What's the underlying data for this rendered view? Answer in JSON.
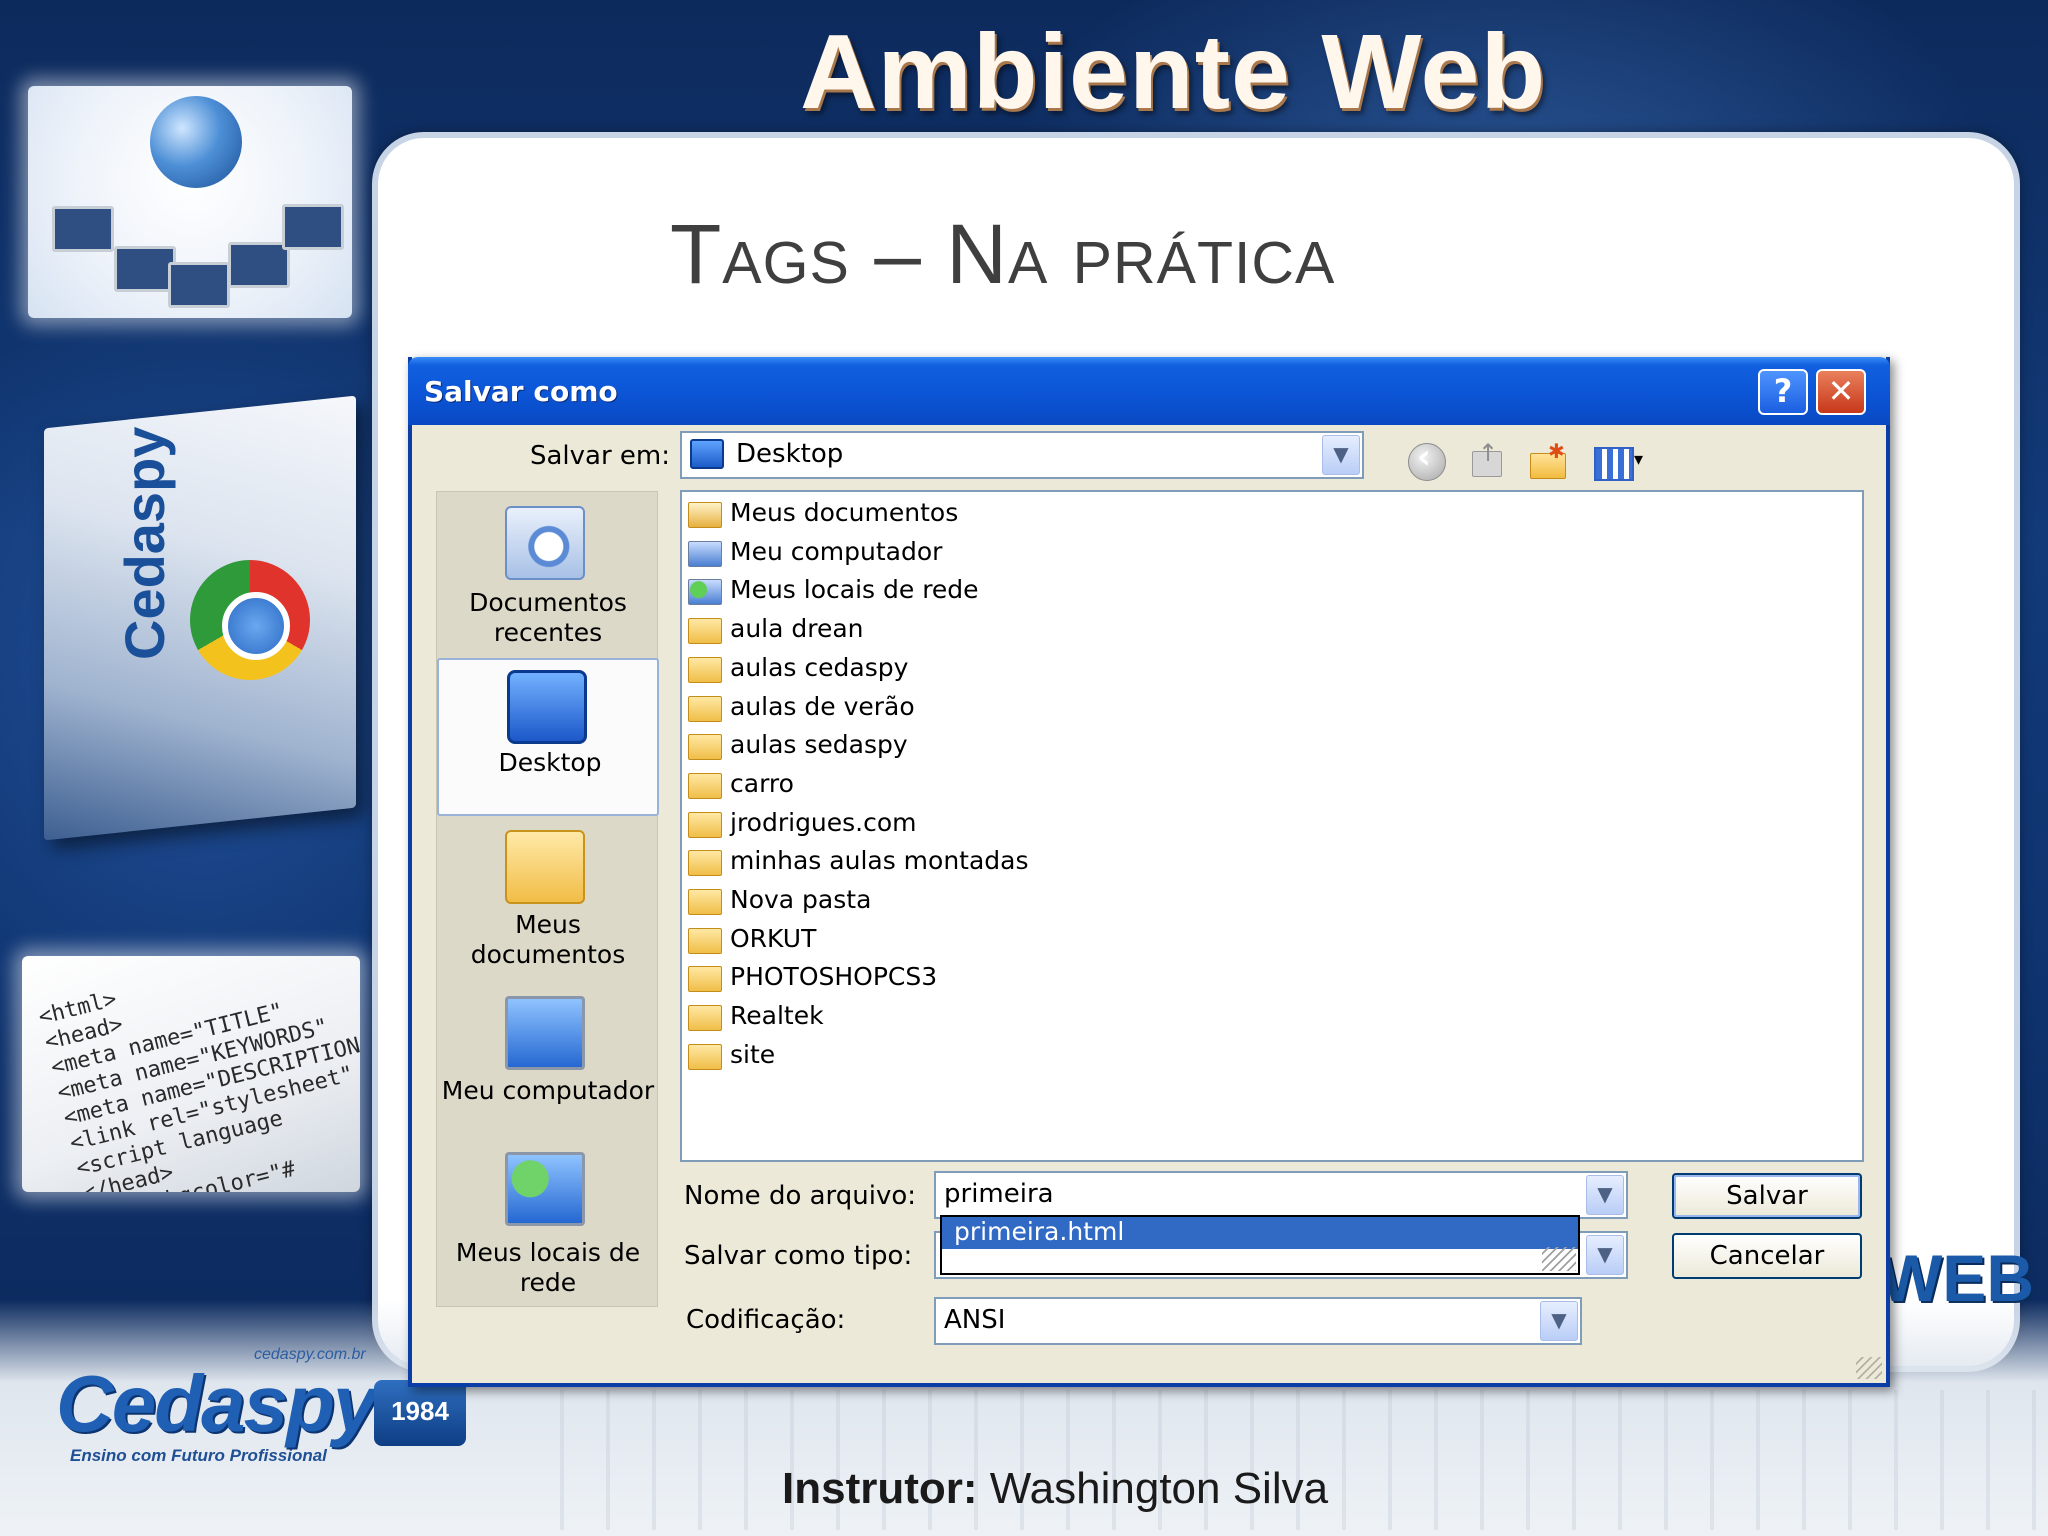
{
  "slide": {
    "title": "Ambiente Web",
    "subtitle": "Tags – Na prática",
    "instructor_label": "Instrutor:",
    "instructor_name": "Washington Silva",
    "book_brand": "Cedaspy",
    "side_logo_text": "WEB"
  },
  "logo": {
    "url": "cedaspy.com.br",
    "name": "Cedaspy",
    "badge": "1984",
    "tagline": "Ensino com Futuro Profissional"
  },
  "code_snippet": [
    "<html>",
    "<head>",
    "<meta name=\"TITLE\"",
    "<meta name=\"KEYWORDS\"",
    "<meta name=\"DESCRIPTION\"",
    "<link rel=\"stylesheet\"",
    "<script language",
    "</head>",
    "<body bgcolor=\"#"
  ],
  "dialog": {
    "title": "Salvar como",
    "help_button": "?",
    "close_button": "✕",
    "save_in_label": "Salvar em:",
    "save_in_value": "Desktop",
    "places": [
      {
        "label": "Documentos\nrecentes",
        "icon": "recent-documents-icon"
      },
      {
        "label": "Desktop",
        "icon": "desktop-icon"
      },
      {
        "label": "Meus\ndocumentos",
        "icon": "my-documents-icon"
      },
      {
        "label": "Meu computador",
        "icon": "my-computer-icon"
      },
      {
        "label": "Meus locais de\nrede",
        "icon": "network-places-icon"
      }
    ],
    "files": [
      {
        "name": "Meus documentos",
        "icon": "my-documents-icon"
      },
      {
        "name": "Meu computador",
        "icon": "my-computer-icon"
      },
      {
        "name": "Meus locais de rede",
        "icon": "network-places-icon"
      },
      {
        "name": "aula drean",
        "icon": "folder-icon"
      },
      {
        "name": "aulas cedaspy",
        "icon": "folder-icon"
      },
      {
        "name": "aulas de verão",
        "icon": "folder-icon"
      },
      {
        "name": "aulas sedaspy",
        "icon": "folder-icon"
      },
      {
        "name": "carro",
        "icon": "folder-icon"
      },
      {
        "name": "jrodrigues.com",
        "icon": "folder-icon"
      },
      {
        "name": "minhas aulas montadas",
        "icon": "folder-icon"
      },
      {
        "name": "Nova pasta",
        "icon": "folder-icon"
      },
      {
        "name": "ORKUT",
        "icon": "folder-icon"
      },
      {
        "name": "PHOTOSHOPCS3",
        "icon": "folder-icon"
      },
      {
        "name": "Realtek",
        "icon": "folder-icon"
      },
      {
        "name": "site",
        "icon": "folder-icon"
      }
    ],
    "filename_label": "Nome do arquivo:",
    "filename_value": "primeira",
    "autocomplete_suggestion": "primeira.html",
    "filetype_label": "Salvar como tipo:",
    "filetype_value": "",
    "encoding_label": "Codificação:",
    "encoding_value": "ANSI",
    "save_button": "Salvar",
    "cancel_button": "Cancelar"
  },
  "colors": {
    "titlebar": "#0b55d6",
    "dialog_bg": "#ece9d8",
    "selection": "#316ac5",
    "slide_bg": "#123a78"
  }
}
